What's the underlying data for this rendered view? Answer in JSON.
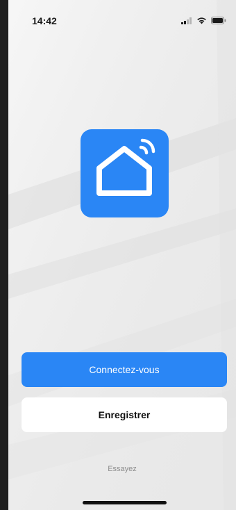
{
  "status_bar": {
    "time": "14:42",
    "icons": [
      "cellular-signal-icon",
      "wifi-icon",
      "battery-icon"
    ]
  },
  "app": {
    "logo_icon": "smart-home-icon",
    "brand_color": "#2a86f5"
  },
  "actions": {
    "login_label": "Connectez-vous",
    "register_label": "Enregistrer",
    "try_label": "Essayez"
  },
  "colors": {
    "background": "#ececec",
    "primary": "#2a86f5",
    "secondary_button": "#ffffff",
    "muted_text": "#8d8d8d"
  }
}
